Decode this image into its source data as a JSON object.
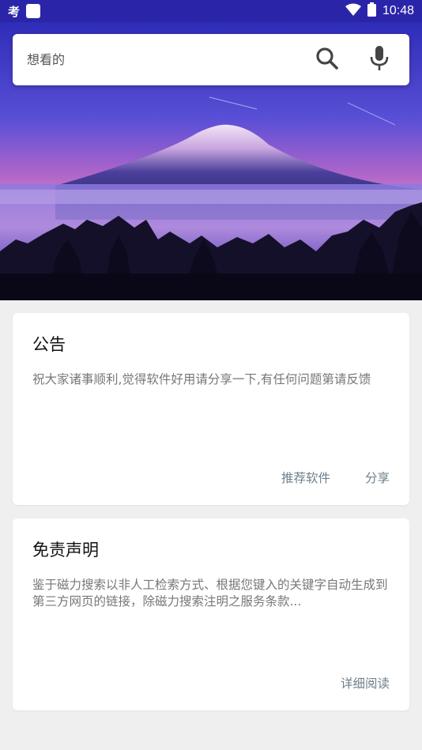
{
  "status_bar": {
    "app_glyph": "考",
    "time": "10:48",
    "icons": [
      "app-icon",
      "notification-square-icon",
      "wifi-icon",
      "battery-icon"
    ]
  },
  "search": {
    "placeholder": "想看的",
    "value": "",
    "search_icon": "search-icon",
    "mic_icon": "mic-icon"
  },
  "hero": {
    "image": "mountain-landscape"
  },
  "notice_card": {
    "title": "公告",
    "body": "祝大家诸事顺利,觉得软件好用请分享一下,有任何问题第请反馈",
    "actions": [
      "推荐软件",
      "分享"
    ]
  },
  "disclaimer_card": {
    "title": "免责声明",
    "body": "鉴于磁力搜索以非人工检索方式、根据您键入的关键字自动生成到第三方网页的链接，除磁力搜索注明之服务条款...",
    "actions": [
      "详细阅读"
    ]
  },
  "colors": {
    "status_bar": "#2a25a8",
    "background": "#efefef",
    "action_text": "#6d7f8a"
  }
}
